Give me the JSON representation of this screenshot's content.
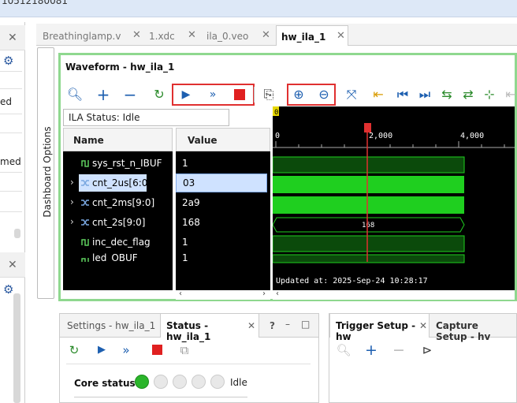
{
  "topbar": {
    "text": "10512180081"
  },
  "left_panel": {
    "items": [
      "ed",
      "med"
    ]
  },
  "dashboard_options": "Dashboard Options",
  "tabs": [
    {
      "label": "Breathinglamp.v"
    },
    {
      "label": "1.xdc"
    },
    {
      "label": "ila_0.veo"
    },
    {
      "label": "hw_ila_1"
    }
  ],
  "waveform": {
    "title": "Waveform - hw_ila_1",
    "ila_status": "ILA Status: Idle",
    "name_header": "Name",
    "value_header": "Value",
    "signals": [
      {
        "name": "sys_rst_n_IBUF",
        "value": "1",
        "icon": "bit-icon"
      },
      {
        "name": "cnt_2us[6:0]",
        "value": "03",
        "icon": "bus-icon",
        "expandable": true,
        "selected": true
      },
      {
        "name": "cnt_2ms[9:0]",
        "value": "2a9",
        "icon": "bus-icon",
        "expandable": true
      },
      {
        "name": "cnt_2s[9:0]",
        "value": "168",
        "icon": "bus-icon",
        "expandable": true
      },
      {
        "name": "inc_dec_flag",
        "value": "1",
        "icon": "bit-icon"
      },
      {
        "name": "led_OBUF",
        "value": "1",
        "icon": "bit-icon"
      }
    ],
    "marker": "0",
    "ruler": [
      "0",
      "2,000",
      "4,000"
    ],
    "cnt_2s_label": "168",
    "updated": "Updated at: 2025-Sep-24 10:28:17"
  },
  "bottom_left": {
    "tabs": [
      {
        "label": "Settings - hw_ila_1"
      },
      {
        "label": "Status - hw_ila_1"
      }
    ],
    "help": "?",
    "core_status_label": "Core status",
    "core_status_value": "Idle"
  },
  "bottom_right": {
    "tabs": [
      {
        "label": "Trigger Setup - hw"
      },
      {
        "label": "Capture Setup - hv"
      }
    ]
  },
  "colors": {
    "accent_green": "#2bb52b",
    "wave_green": "#1fcf1f",
    "marker_red": "#e03030",
    "highlight_box": "#e03030"
  }
}
